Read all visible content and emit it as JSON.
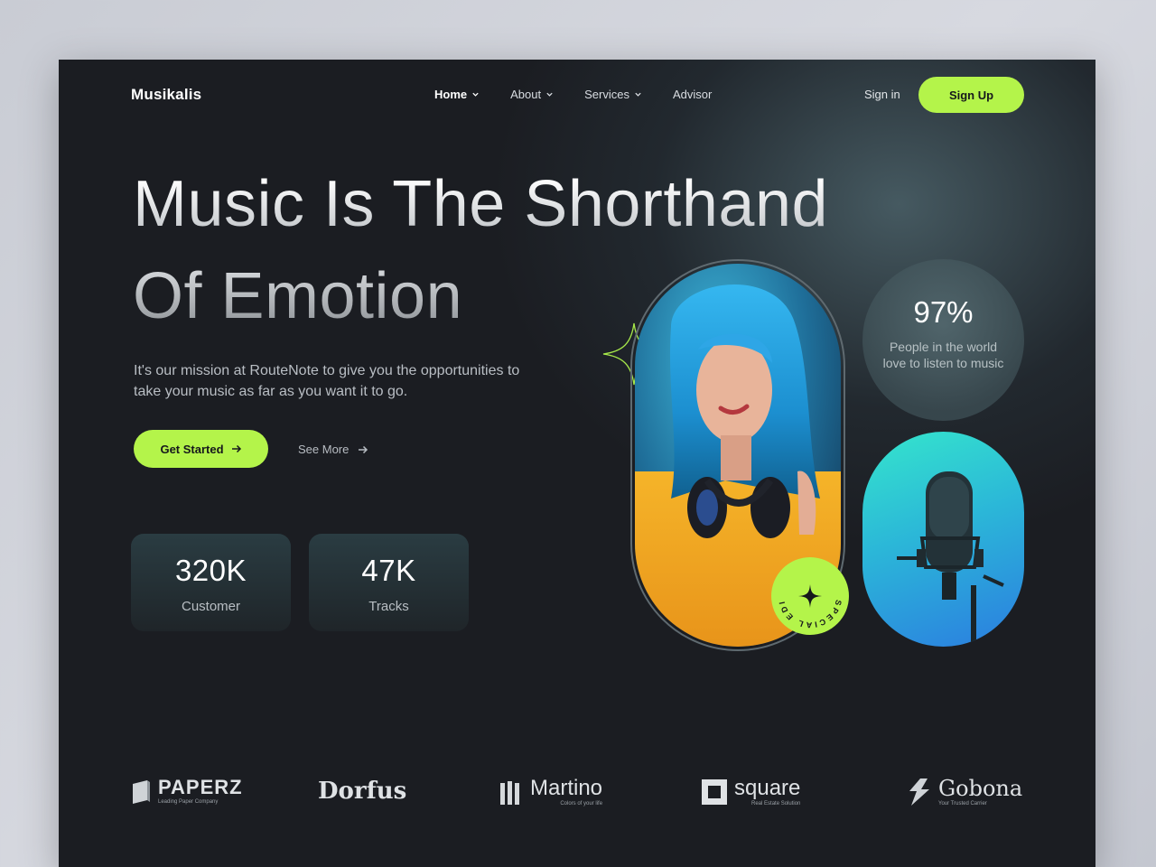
{
  "brand": "Musikalis",
  "nav": [
    {
      "label": "Home",
      "dropdown": true,
      "active": true
    },
    {
      "label": "About",
      "dropdown": true,
      "active": false
    },
    {
      "label": "Services",
      "dropdown": true,
      "active": false
    },
    {
      "label": "Advisor",
      "dropdown": false,
      "active": false
    }
  ],
  "auth": {
    "signin": "Sign in",
    "signup": "Sign Up"
  },
  "hero": {
    "title_line1": "Music Is The Shorthand",
    "title_line2": "Of Emotion",
    "subtitle": "It's our mission at RouteNote to give you the opportunities to take your music as far as you want it to go.",
    "cta_primary": "Get Started",
    "cta_secondary": "See More"
  },
  "stats": [
    {
      "value": "320K",
      "label": "Customer"
    },
    {
      "value": "47K",
      "label": "Tracks"
    }
  ],
  "highlight": {
    "value": "97%",
    "text": "People in the world love to listen to music"
  },
  "badge": {
    "text": "SPECIAL EDITION"
  },
  "partners": [
    {
      "name": "PAPERZ",
      "tagline": "Leading Paper Company"
    },
    {
      "name": "Dorfus",
      "tagline": ""
    },
    {
      "name": "Martino",
      "tagline": "Colors of your life"
    },
    {
      "name": "square",
      "tagline": "Real Estate Solution"
    },
    {
      "name": "Gobona",
      "tagline": "Your Trusted Carrier"
    }
  ],
  "colors": {
    "accent": "#b4f44a",
    "background": "#1b1d22",
    "mic_gradient_start": "#35e6cc",
    "mic_gradient_end": "#2b7de0"
  }
}
